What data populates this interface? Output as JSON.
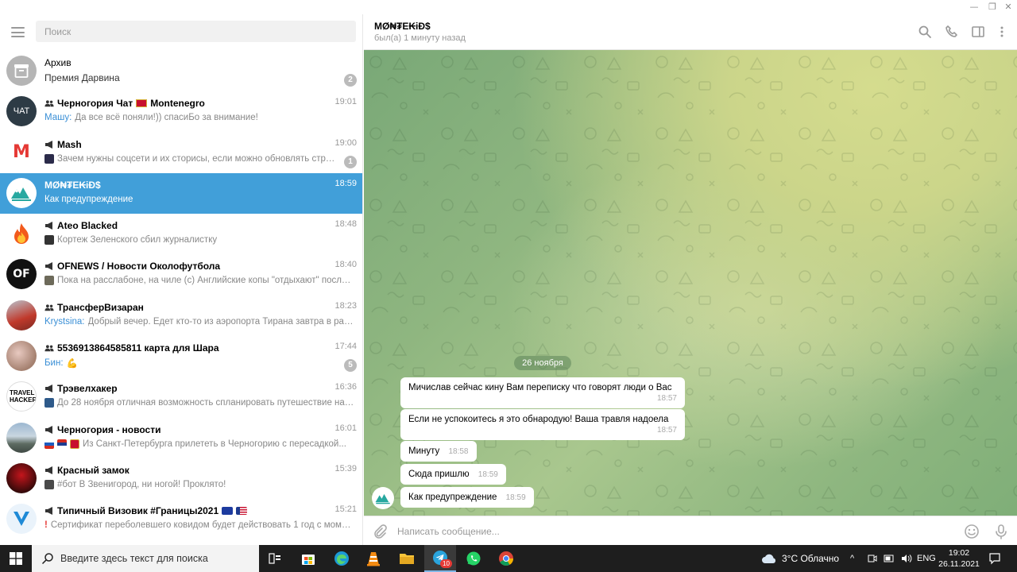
{
  "window": {
    "minimize": "—",
    "maximize": "❐",
    "close": "✕"
  },
  "search": {
    "placeholder": "Поиск"
  },
  "chats": [
    {
      "title": "Архив",
      "message": "Премия Дарвина",
      "badge": "2"
    },
    {
      "title": "Черногория Чат",
      "title_suffix": "Montenegro",
      "time": "19:01",
      "sender": "Машу:",
      "message": "Да все всё поняли!)) спасиБо за внимание!",
      "avatar_text": "ЧАТ"
    },
    {
      "title": "Mash",
      "time": "19:00",
      "message": "Зачем нужны соцсети и их сторисы, если можно обновлять стран...",
      "badge": "1",
      "avatar_text": "M"
    },
    {
      "title": "MØ₦₮E₭iĐ$",
      "time": "18:59",
      "message": "Как предупреждение"
    },
    {
      "title": "Ateo Blacked",
      "time": "18:48",
      "message": "Кортеж Зеленского сбил журналистку"
    },
    {
      "title": "OFNEWS / Новости Околофутбола",
      "time": "18:40",
      "message": "Пока на расслабоне, на чиле (с)  Английские копы \"отдыхают\" после в...",
      "avatar_text": "OF"
    },
    {
      "title": "ТрансферВизаран",
      "time": "18:23",
      "sender": "Krystsina:",
      "message": "Добрый вечер. Едет кто-то из аэропорта Тирана завтра в район..."
    },
    {
      "title": "5536913864585811 карта для Шара",
      "time": "17:44",
      "sender": "Бин:",
      "message": "💪",
      "badge": "5"
    },
    {
      "title": "Трэвелхакер",
      "time": "16:36",
      "message": "До 28 ноября отличная возможность спланировать путешествие на г...",
      "avatar_text": "TRAVEL HACKER"
    },
    {
      "title": "Черногория - новости",
      "time": "16:01",
      "message": "Из Санкт-Петербурга прилететь в Черногорию с пересадкой..."
    },
    {
      "title": "Красный замок",
      "time": "15:39",
      "message": "#бот  В Звенигород, ни ногой! Проклято!"
    },
    {
      "title": "Типичный Визовик #Границы2021",
      "time": "15:21",
      "message": "Сертификат переболевшего ковидом будет действовать 1 год с момен..."
    }
  ],
  "header": {
    "title": "MØ₦₮E₭iĐ$",
    "status": "был(а) 1 минуту назад"
  },
  "conversation": {
    "date": "26 ноября",
    "messages": [
      {
        "text": "Мичислав сейчас кину Вам переписку что говорят люди о Вас",
        "time": "18:57"
      },
      {
        "text": "Если не успокоитесь я это обнародую! Ваша травля надоела",
        "time": "18:57"
      },
      {
        "text": "Минуту",
        "time": "18:58"
      },
      {
        "text": "Сюда пришлю",
        "time": "18:59"
      },
      {
        "text": "Как предупреждение",
        "time": "18:59"
      }
    ]
  },
  "composer": {
    "placeholder": "Написать сообщение..."
  },
  "taskbar": {
    "search_placeholder": "Введите здесь текст для поиска",
    "telegram_badge": "10",
    "weather": "3°C  Облачно",
    "lang": "ENG",
    "time": "19:02",
    "date": "26.11.2021"
  },
  "colors": {
    "accent": "#419fd9",
    "sender": "#3a8fd6",
    "badge": "#bbbbbb"
  }
}
